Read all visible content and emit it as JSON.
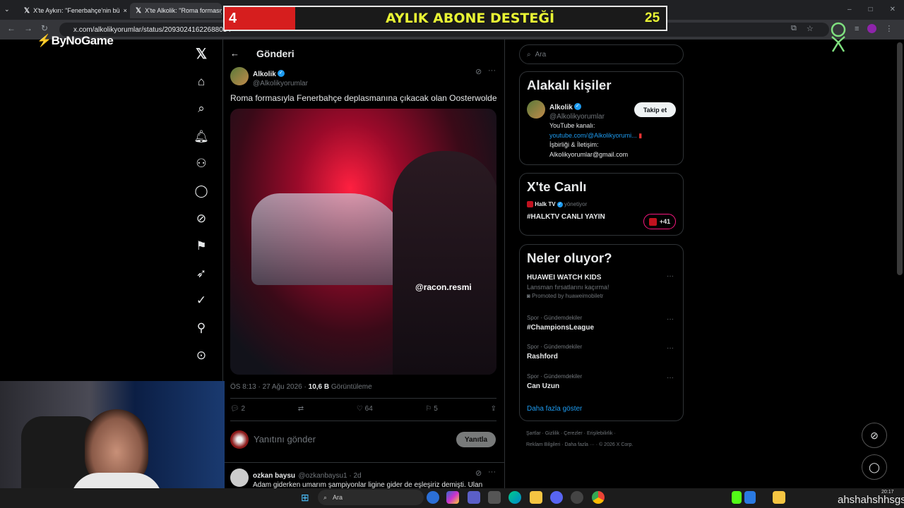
{
  "browser": {
    "tabs": [
      {
        "label": "X'te Aykırı: \"Fenerbahçe'nin bü"
      },
      {
        "label": "X'te Alkolik: \"Roma formasıy"
      }
    ],
    "url": "x.com/alkolikyorumlar/status/20930241622688034"
  },
  "overlay": {
    "left_count": "4",
    "title": "AYLIK ABONE DESTEĞİ",
    "right_count": "25",
    "logo": "ByNoGame"
  },
  "post": {
    "header_title": "Gönderi",
    "author_name": "Alkolik",
    "author_handle": "@Alkolikyorumlar",
    "text": "Roma formasıyla  Fenerbahçe deplasmanına çıkacak olan  Oosterwolde",
    "watermark": "@racon.resmi",
    "time": "ÖS 8:13 · 27 Ağu 2026 · ",
    "views": "10,6 B",
    "views_label": " Görüntüleme",
    "replies": "2",
    "likes": "64",
    "bookmarks": "5",
    "reply_placeholder": "Yanıtını gönder",
    "reply_button": "Yanıtla"
  },
  "reply": {
    "name": "ozkan baysu",
    "handle": "@ozkanbaysu1 · 2d",
    "text": "Adam giderken umarım şampiyonlar ligine gider de eşleşiriz demişti. Ulan"
  },
  "sidebar": {
    "search_placeholder": "Ara",
    "related_title": "Alakalı kişiler",
    "related_name": "Alkolik",
    "related_handle": "@Alkolikyorumlar",
    "follow_label": "Takip et",
    "bio_line1": "YouTube kanalı:",
    "bio_link": "youtube.com/@Alkolikyorumi...",
    "bio_line2": "İşbirliği & İletişim:",
    "bio_line3": "Alkolikyorumlar@gmail.com",
    "live_title": "X'te Canlı",
    "live_host": "Halk TV",
    "live_role": "yönetiyor",
    "live_name": "#HALKTV CANLI YAYIN",
    "live_count": "+41",
    "trends_title": "Neler oluyor?",
    "trends": [
      {
        "category": "",
        "name": "HUAWEI WATCH KIDS",
        "sub": "Lansman fırsatlarını kaçırma!",
        "promo": "Promoted by huaweimobiletr"
      },
      {
        "category": "Spor · Gündemdekiler",
        "name": "#ChampionsLeague"
      },
      {
        "category": "Spor · Gündemdekiler",
        "name": "Rashford"
      },
      {
        "category": "Spor · Gündemdekiler",
        "name": "Can Uzun"
      }
    ],
    "show_more": "Daha fazla göster",
    "footer1": "Şartlar  ·  Gizlilik  ·  Çerezler  ·  Erişilebilirlik  ·",
    "footer2": "Reklam Bilgileri  ·  Daha fazla ···  ·  © 2026 X Corp."
  },
  "taskbar": {
    "search": "Ara",
    "clock_time": "20:17",
    "ticker": "ahshahshhsgs"
  }
}
